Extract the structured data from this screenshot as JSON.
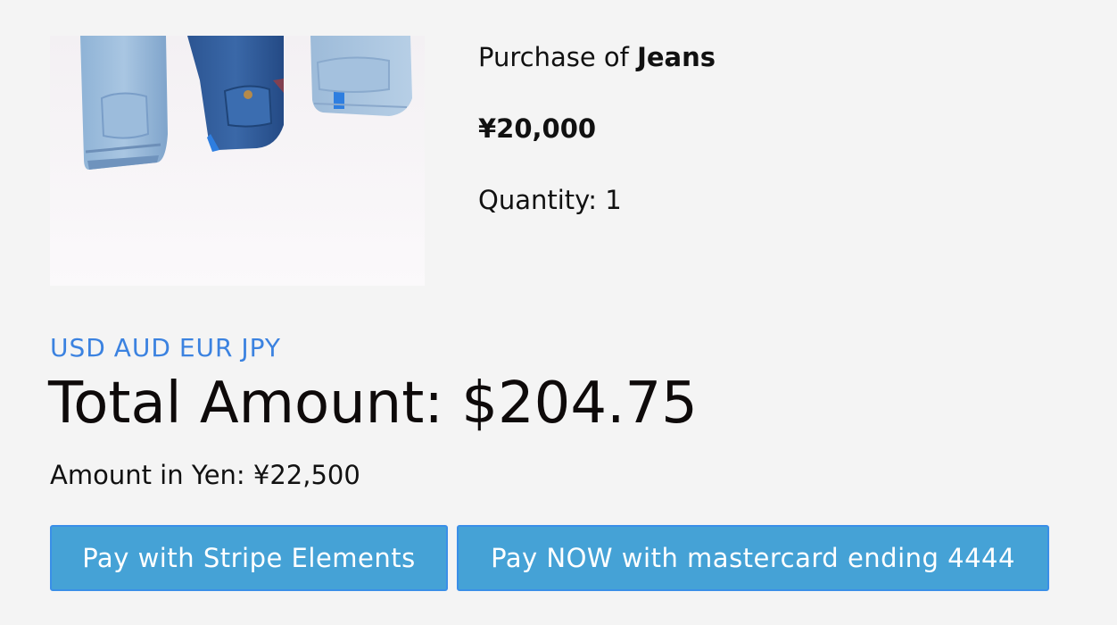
{
  "product": {
    "purchase_prefix": "Purchase of",
    "name": "Jeans",
    "price": "¥20,000",
    "quantity_text": "Quantity: 1",
    "image_icon": "jeans-photo"
  },
  "currencies": [
    {
      "code": "USD"
    },
    {
      "code": "AUD"
    },
    {
      "code": "EUR"
    },
    {
      "code": "JPY"
    }
  ],
  "total": {
    "text": "Total Amount: $204.75"
  },
  "yen": {
    "text": "Amount in Yen: ¥22,500"
  },
  "buttons": {
    "stripe_label": "Pay with Stripe Elements",
    "mastercard_label": "Pay NOW with mastercard ending 4444"
  },
  "colors": {
    "background": "#f4f4f4",
    "link": "#3b82e0",
    "button": "#45a2d6",
    "button_border": "#3a8fe8"
  }
}
